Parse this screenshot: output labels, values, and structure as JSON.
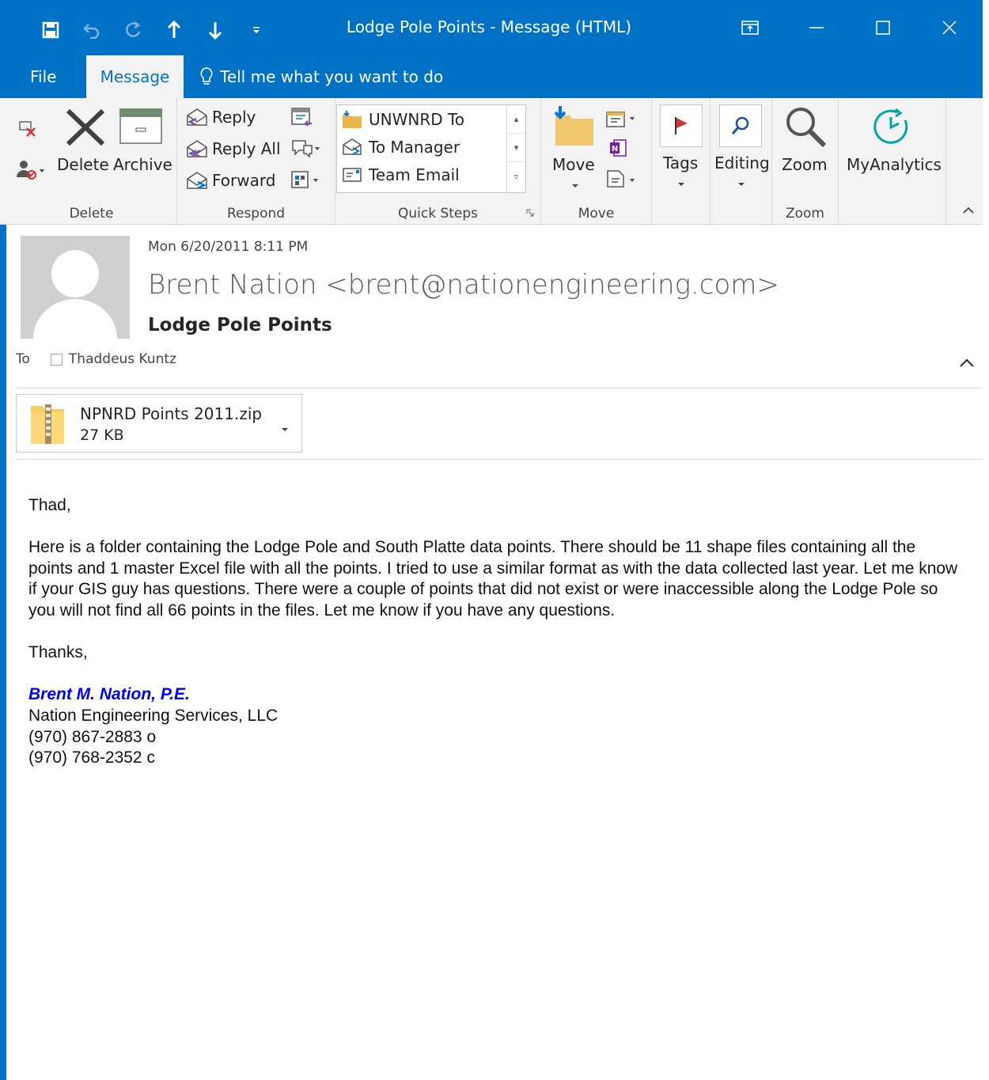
{
  "window": {
    "title": "Lodge Pole Points - Message (HTML)"
  },
  "tabs": {
    "file": "File",
    "message": "Message",
    "tell_me": "Tell me what you want to do"
  },
  "ribbon": {
    "delete_group": {
      "label": "Delete",
      "delete": "Delete",
      "archive": "Archive"
    },
    "respond_group": {
      "label": "Respond",
      "reply": "Reply",
      "reply_all": "Reply All",
      "forward": "Forward"
    },
    "quick_steps_group": {
      "label": "Quick Steps",
      "items": [
        "UNWNRD To",
        "To Manager",
        "Team Email"
      ]
    },
    "move_group": {
      "label": "Move",
      "move": "Move"
    },
    "tags": "Tags",
    "editing": "Editing",
    "zoom_group": {
      "label": "Zoom",
      "zoom": "Zoom"
    },
    "myanalytics": "MyAnalytics"
  },
  "message": {
    "date": "Mon 6/20/2011 8:11 PM",
    "from": "Brent Nation <brent@nationengineering.com>",
    "subject": "Lodge Pole Points",
    "to_label": "To",
    "to": "Thaddeus Kuntz"
  },
  "attachment": {
    "name": "NPNRD Points 2011.zip",
    "size": "27 KB"
  },
  "body": {
    "greeting": "Thad,",
    "paragraph": "Here is a folder containing the Lodge Pole and South Platte data points. There should be 11 shape files containing all the points and 1 master Excel file with all the points. I tried to use a similar format as with the data collected last year. Let me know if your GIS guy has questions. There were a couple of points that did not exist or were inaccessible along the Lodge Pole so you will not find all 66 points in the files. Let me know if you have any questions.",
    "closing": "Thanks,",
    "signature": {
      "name": "Brent M. Nation, P.E.",
      "company": "Nation Engineering Services, LLC",
      "phone_office": "(970) 867-2883 o",
      "phone_cell": "(970) 768-2352 c"
    }
  },
  "colors": {
    "accent": "#0072c6",
    "ribbon_bg": "#f3f3f3",
    "signature": "#0000ee"
  }
}
